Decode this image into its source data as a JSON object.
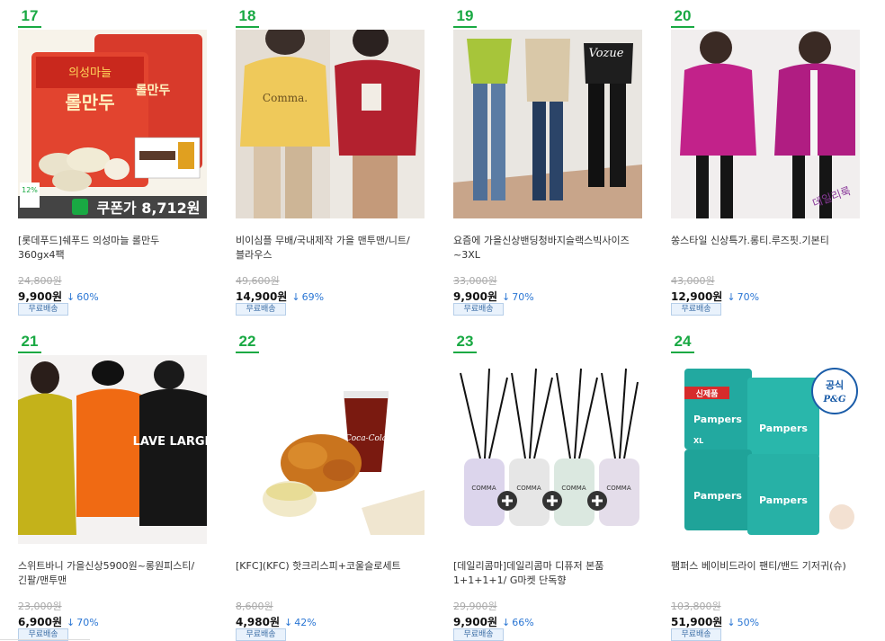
{
  "products": [
    {
      "rank": "17",
      "title": "[롯데푸드]쉐푸드 의성마늘 롤만두 360gx4팩",
      "original_price": "24,800원",
      "sale_price": "9,900원",
      "discount": "60%",
      "shipping": "무료배송",
      "thumb": {
        "kind": "dumpling",
        "pkg_text": "롤만두",
        "brand_text": "의성마늘",
        "coupon_text": "쿠폰가 8,712원",
        "badge_text": "12%"
      }
    },
    {
      "rank": "18",
      "title": "비이심플 무배/국내제작 가을 맨투맨/니트/블라우스",
      "original_price": "49,600원",
      "sale_price": "14,900원",
      "discount": "69%",
      "shipping": "무료배송",
      "thumb": {
        "kind": "sweaters",
        "shirt_text": "Comma."
      }
    },
    {
      "rank": "19",
      "title": "요즘에 가을신상밴딩청바지슬랙스빅사이즈~3XL",
      "original_price": "33,000원",
      "sale_price": "9,900원",
      "discount": "70%",
      "shipping": "무료배송",
      "thumb": {
        "kind": "pants",
        "logo_text": "Vozue"
      }
    },
    {
      "rank": "20",
      "title": "쏭스타일 신상특가.롱티.루즈핏.기본티",
      "original_price": "43,000원",
      "sale_price": "12,900원",
      "discount": "70%",
      "shipping": "무료배송",
      "thumb": {
        "kind": "hoodie",
        "corner_text": "데일리룩"
      }
    },
    {
      "rank": "21",
      "title": "스위트바니 가을신상5900원~롱원피스티/긴팔/맨투맨",
      "original_price": "23,000원",
      "sale_price": "6,900원",
      "discount": "70%",
      "shipping": "무료배송",
      "thumb": {
        "kind": "longtee",
        "print_text": "LAVE LARGE"
      }
    },
    {
      "rank": "22",
      "title": "[KFC](KFC) 핫크리스피+코울슬로세트",
      "original_price": "8,600원",
      "sale_price": "4,980원",
      "discount": "42%",
      "shipping": "무료배송",
      "thumb": {
        "kind": "chicken",
        "cup_text": "Coca-Cola"
      }
    },
    {
      "rank": "23",
      "title": "[데일리콤마]데일리콤마 디퓨저 본품 1+1+1+1/ G마켓 단독향",
      "original_price": "29,900원",
      "sale_price": "9,900원",
      "discount": "66%",
      "shipping": "무료배송",
      "thumb": {
        "kind": "diffuser",
        "label_text": "COMMA"
      }
    },
    {
      "rank": "24",
      "title": "팸퍼스 베이비드라이 팬티/밴드 기저귀(슈)",
      "original_price": "103,800원",
      "sale_price": "51,900원",
      "discount": "50%",
      "shipping": "무료배송",
      "thumb": {
        "kind": "diapers",
        "brand_text": "Pampers",
        "new_badge": "신제품",
        "official_badge": "공식",
        "pg_text": "P&G",
        "size_text": "XL"
      }
    }
  ],
  "colors": {
    "rank_green": "#19a943",
    "discount_blue": "#2a76d4",
    "ship_border": "#b7cfe9",
    "ship_bg": "#e9f2fc"
  },
  "icons": {
    "discount_arrow": "down-arrow-icon"
  }
}
